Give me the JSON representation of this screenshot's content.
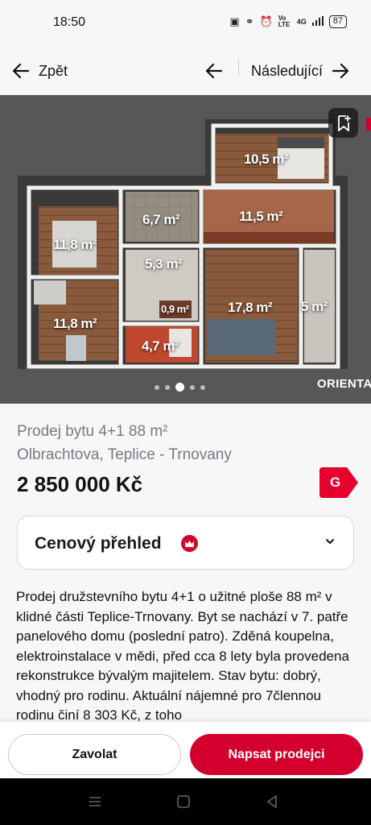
{
  "status_bar": {
    "time": "18:50",
    "icons": [
      "nfc-icon",
      "headphones-icon",
      "alarm-icon",
      "volte-icon",
      "signal-4g-icon",
      "signal-bars-icon"
    ],
    "volte_text": "Vo LTE",
    "network_text": "4G",
    "battery": "87"
  },
  "nav": {
    "back_label": "Zpět",
    "next_label": "Následující"
  },
  "gallery": {
    "rooms": [
      {
        "label": "10,5 m²"
      },
      {
        "label": "6,7 m²"
      },
      {
        "label": "11,5 m²"
      },
      {
        "label": "11,8 m²"
      },
      {
        "label": "5,3 m²"
      },
      {
        "label": "0,9 m²"
      },
      {
        "label": "17,8 m²"
      },
      {
        "label": "5 m²"
      },
      {
        "label": "11,8 m²"
      },
      {
        "label": "4,7 m²"
      }
    ],
    "watermark": "ORIENTA",
    "total_images": 5,
    "active_index": 2
  },
  "listing": {
    "title": "Prodej bytu 4+1 88 m²",
    "address": "Olbrachtova, Teplice - Trnovany",
    "price": "2 850 000 Kč",
    "energy_class": "G",
    "energy_color": "#e8002d"
  },
  "price_overview": {
    "label": "Cenový přehled"
  },
  "description": {
    "text": "Prodej družstevního bytu 4+1 o užitné ploše 88 m² v klidné části Teplice-Trnovany. Byt se nachází v 7. patře panelového domu (poslední patro). Zděná koupelna, elektroinstalace v mědi, před cca 8 lety byla provedena rekonstrukce bývalým majitelem. Stav bytu: dobrý, vhodný pro rodinu. Aktuální nájemné pro 7člennou rodinu činí 8 303 Kč, z toho"
  },
  "actions": {
    "call_label": "Zavolat",
    "write_label": "Napsat prodejci"
  },
  "colors": {
    "accent": "#d3002b",
    "muted_text": "#777a82"
  }
}
